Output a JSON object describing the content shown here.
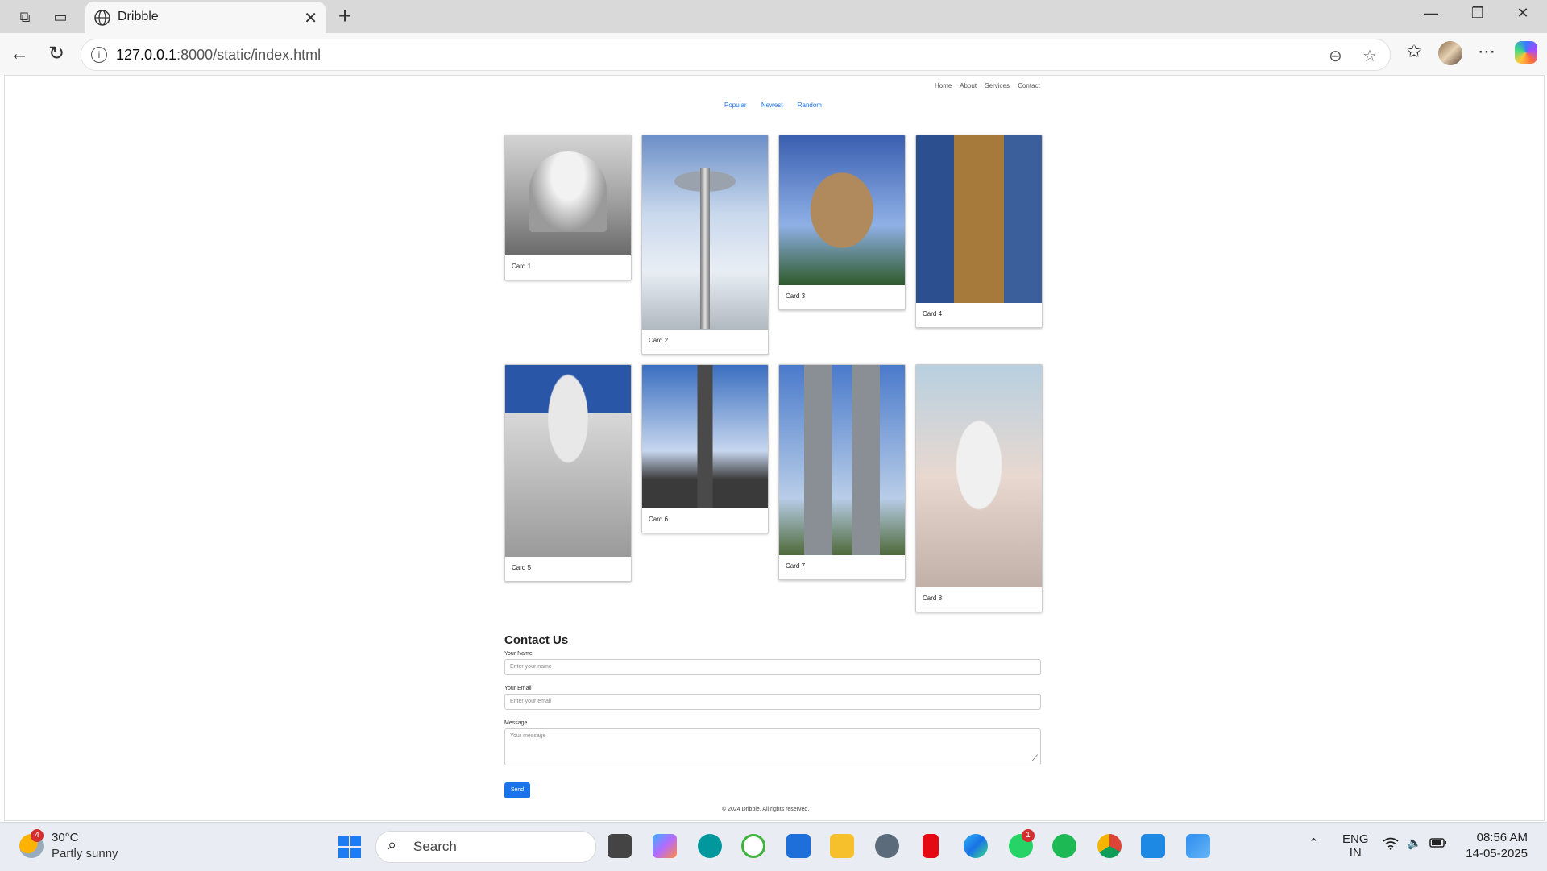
{
  "browser": {
    "tab_title": "Dribble",
    "url_host": "127.0.0.1",
    "url_path": ":8000/static/index.html"
  },
  "page": {
    "nav": [
      "Home",
      "About",
      "Services",
      "Contact"
    ],
    "filters": [
      "Popular",
      "Newest",
      "Random"
    ],
    "cards": [
      "Card 1",
      "Card 2",
      "Card 3",
      "Card 4",
      "Card 5",
      "Card 6",
      "Card 7",
      "Card 8"
    ],
    "contact": {
      "heading": "Contact Us",
      "name_label": "Your Name",
      "name_placeholder": "Enter your name",
      "email_label": "Your Email",
      "email_placeholder": "Enter your email",
      "message_label": "Message",
      "message_placeholder": "Your message",
      "send_label": "Send"
    },
    "footer": "© 2024 Dribble. All rights reserved."
  },
  "taskbar": {
    "weather_badge": "4",
    "weather_temp": "30°C",
    "weather_desc": "Partly sunny",
    "search_label": "Search",
    "whatsapp_badge": "1",
    "lang_1": "ENG",
    "lang_2": "IN",
    "time": "08:56 AM",
    "date": "14-05-2025"
  },
  "colors": {
    "accent": "#1a73e8",
    "taskbar_bg": "#e9edf3",
    "tabbar_bg": "#d9d9d9"
  },
  "icons": [
    "workspaces-icon",
    "tab-actions-icon",
    "globe-icon",
    "close-icon",
    "new-tab-icon",
    "minimize-icon",
    "restore-icon",
    "window-close-icon",
    "back-icon",
    "refresh-icon",
    "info-icon",
    "zoom-icon",
    "star-icon",
    "favorites-icon",
    "more-icon",
    "copilot-icon",
    "windows-start-icon",
    "search-icon",
    "wifi-icon",
    "volume-icon",
    "battery-icon"
  ]
}
